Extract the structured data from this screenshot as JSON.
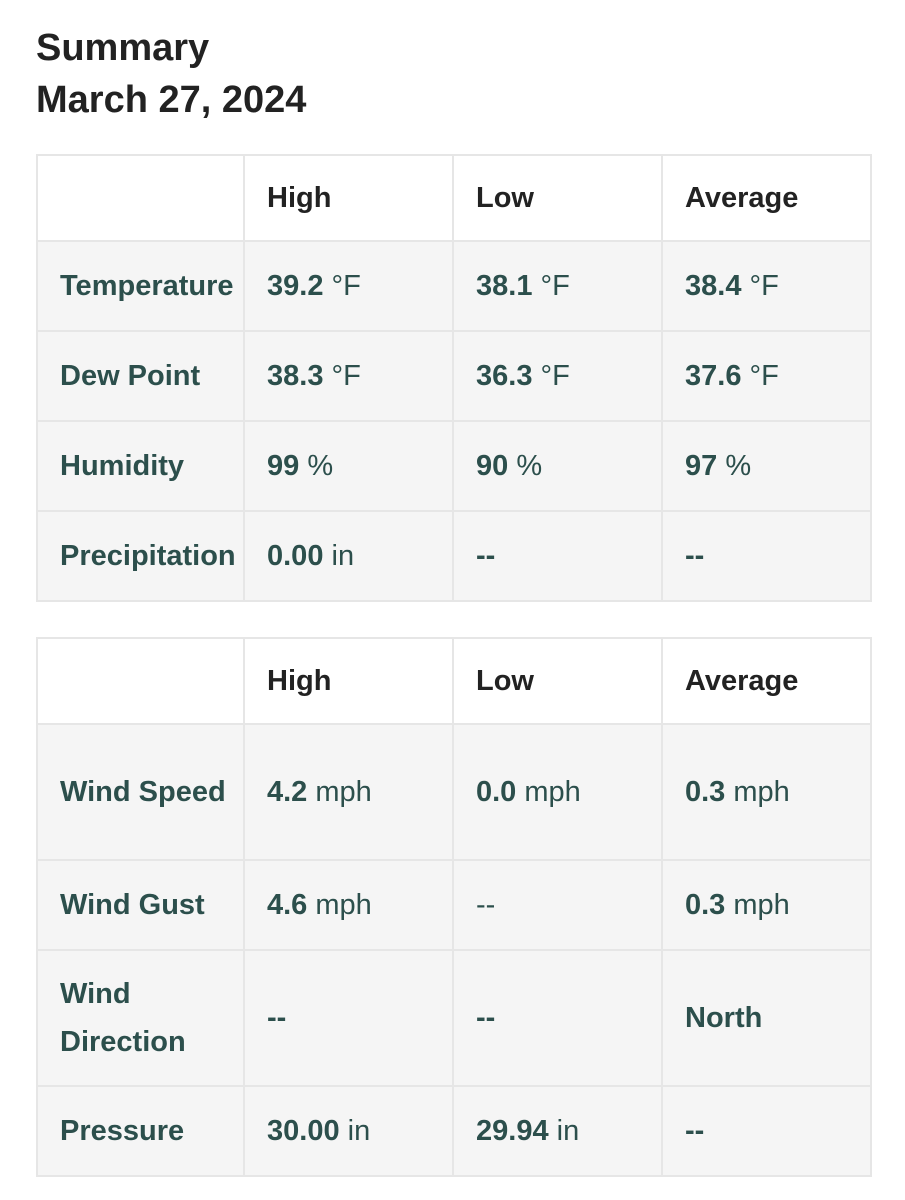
{
  "header": {
    "title": "Summary",
    "date": "March 27, 2024"
  },
  "columns": [
    "",
    "High",
    "Low",
    "Average"
  ],
  "table1": {
    "rows": [
      {
        "label": "Temperature",
        "high": {
          "value": "39.2",
          "unit": "°F"
        },
        "low": {
          "value": "38.1",
          "unit": "°F"
        },
        "average": {
          "value": "38.4",
          "unit": "°F"
        }
      },
      {
        "label": "Dew Point",
        "high": {
          "value": "38.3",
          "unit": "°F"
        },
        "low": {
          "value": "36.3",
          "unit": "°F"
        },
        "average": {
          "value": "37.6",
          "unit": "°F"
        }
      },
      {
        "label": "Humidity",
        "high": {
          "value": "99",
          "unit": "%"
        },
        "low": {
          "value": "90",
          "unit": "%"
        },
        "average": {
          "value": "97",
          "unit": "%"
        }
      },
      {
        "label": "Precipitation",
        "high": {
          "value": "0.00",
          "unit": "in"
        },
        "low": {
          "value": "--",
          "unit": ""
        },
        "average": {
          "value": "--",
          "unit": ""
        }
      }
    ]
  },
  "table2": {
    "rows": [
      {
        "label": "Wind Speed",
        "high": {
          "value": "4.2",
          "unit": "mph"
        },
        "low": {
          "value": "0.0",
          "unit": "mph"
        },
        "average": {
          "value": "0.3",
          "unit": "mph"
        }
      },
      {
        "label": "Wind Gust",
        "high": {
          "value": "4.6",
          "unit": "mph"
        },
        "low": {
          "value": "--",
          "unit": ""
        },
        "average": {
          "value": "0.3",
          "unit": "mph"
        }
      },
      {
        "label": "Wind Direction",
        "high": {
          "value": "--",
          "unit": ""
        },
        "low": {
          "value": "--",
          "unit": ""
        },
        "average": {
          "value": "North",
          "unit": ""
        }
      },
      {
        "label": "Pressure",
        "high": {
          "value": "30.00",
          "unit": "in"
        },
        "low": {
          "value": "29.94",
          "unit": "in"
        },
        "average": {
          "value": "--",
          "unit": ""
        }
      }
    ]
  },
  "colors": {
    "heading_text": "#222222",
    "value_text": "#2c4f4c",
    "cell_background": "#f5f5f5",
    "header_background": "#ffffff",
    "border": "#e6e6e6"
  }
}
